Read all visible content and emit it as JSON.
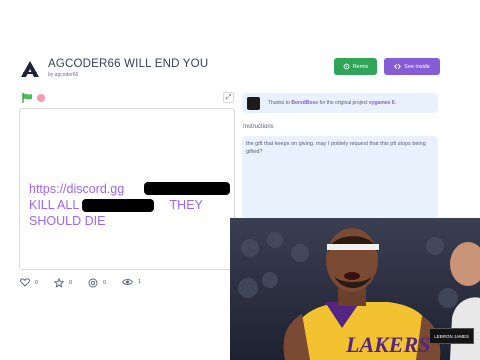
{
  "project": {
    "title": "AGCODER66 WILL END YOU",
    "author": "by agcoder66"
  },
  "buttons": {
    "remix": "Remix",
    "see_inside": "See inside"
  },
  "stage": {
    "line1": "https://discord.gg",
    "line2_start": "KILL ALL",
    "line2_end": "THEY",
    "line3": "SHOULD DIE"
  },
  "stats": {
    "loves": "0",
    "favorites": "0",
    "remixes": "0",
    "views": "1"
  },
  "credit": {
    "prefix": "Thanks to",
    "user": "BoredBoss",
    "suffix": "for the original project",
    "project_link": "sygames II."
  },
  "instructions": {
    "label": "Instructions",
    "text": "the gift that keeps on giving. may I politely request that this pfi stops being gifted?"
  },
  "meme": {
    "team_text": "LAKERS",
    "caption": "LEBRON JAMES"
  },
  "colors": {
    "accent": "#855cd6",
    "remix_green": "#2fa55a",
    "stage_text": "#9966ff",
    "panel_bg": "#e9f1fc"
  }
}
